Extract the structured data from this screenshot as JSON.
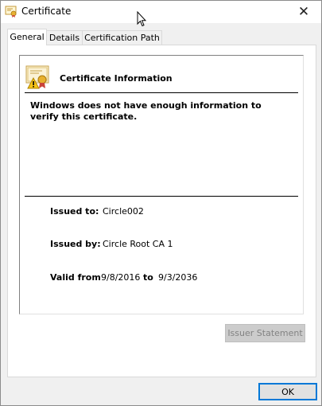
{
  "window": {
    "title": "Certificate",
    "close_glyph": "✕"
  },
  "tabs": [
    {
      "label": "General",
      "active": true
    },
    {
      "label": "Details",
      "active": false
    },
    {
      "label": "Certification Path",
      "active": false
    }
  ],
  "general": {
    "heading": "Certificate Information",
    "warning": "Windows does not have enough information to verify this certificate.",
    "issued_to_label": "Issued to:",
    "issued_to_value": "Circle002",
    "issued_by_label": "Issued by:",
    "issued_by_value": "Circle Root CA 1",
    "valid_from_label": "Valid from",
    "valid_from_value": "9/8/2016",
    "valid_to_label": "to",
    "valid_to_value": "9/3/2036",
    "issuer_statement_label": "Issuer Statement"
  },
  "buttons": {
    "ok_label": "OK"
  },
  "icons": {
    "title": "certificate-icon",
    "info": "certificate-warning-icon",
    "close": "close-icon",
    "cursor": "mouse-pointer-icon"
  },
  "colors": {
    "accent": "#0078d7",
    "disabled_text": "#838383",
    "dialog_bg": "#f0f0f0"
  }
}
